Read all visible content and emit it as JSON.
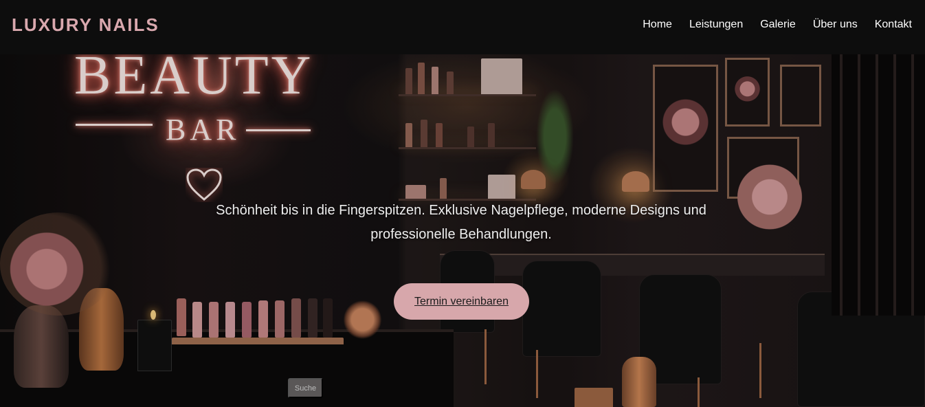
{
  "brand": {
    "name": "LUXURY NAILS",
    "color": "#d9a8ae"
  },
  "nav": {
    "items": [
      "Home",
      "Leistungen",
      "Galerie",
      "Über uns",
      "Kontakt"
    ]
  },
  "hero": {
    "neon_sign_line1": "BEAUTY",
    "neon_sign_line2": "BAR",
    "tagline": "Schönheit bis in die Fingerspitzen. Exklusive Nagelpflege, moderne Designs und professionelle Behandlungen.",
    "cta_label": "Termin vereinbaren",
    "cta_color": "#d7a7ab"
  },
  "search": {
    "label": "Suche"
  }
}
